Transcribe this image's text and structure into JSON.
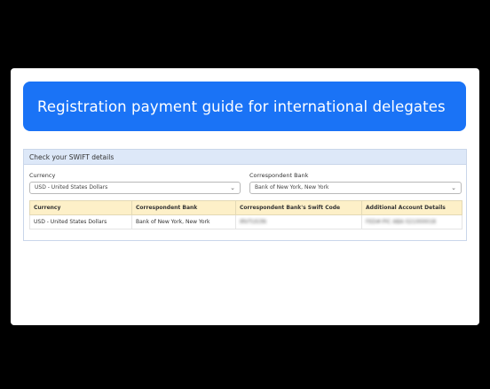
{
  "page": {
    "title": "Registration payment guide for international delegates"
  },
  "swift_panel": {
    "header": "Check your SWIFT details",
    "currency_label": "Currency",
    "currency_value": "USD - United States Dollars",
    "bank_label": "Correspondent Bank",
    "bank_value": "Bank of New York, New York"
  },
  "table": {
    "headers": [
      "Currency",
      "Correspondent Bank",
      "Correspondent Bank's Swift Code",
      "Additional Account Details"
    ],
    "rows": [
      [
        "USD - United States Dollars",
        "Bank of New York, New York",
        "IRVTUS3N",
        "FED#:PIC ABA 021000018"
      ]
    ]
  },
  "colors": {
    "banner": "#1a73f6",
    "panel_header": "#dde8f8",
    "table_header": "#fdf0c8",
    "backdrop": "#000000"
  }
}
